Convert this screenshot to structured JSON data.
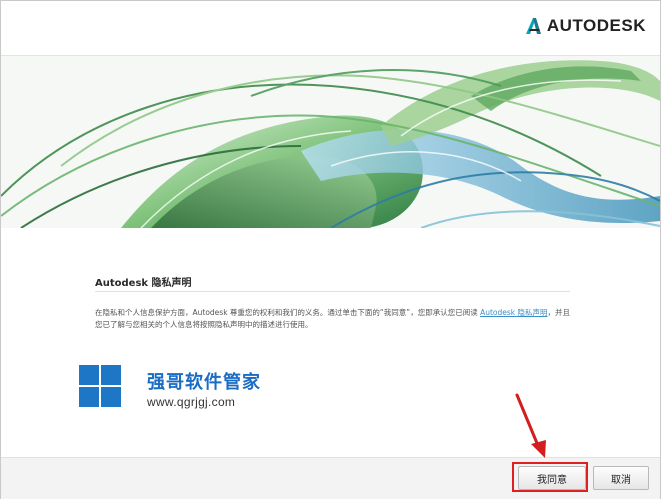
{
  "header": {
    "brand_name": "AUTODESK",
    "logo_icon": "autodesk-a-logo-icon"
  },
  "banner": {
    "image": "abstract-green-blue-ribbons-artwork"
  },
  "privacy": {
    "title": "Autodesk 隐私声明",
    "body_part1": "在隐私和个人信息保护方面，Autodesk 尊重您的权利和我们的义务。通过单击下面的“我同意”，您即承认您已阅读 ",
    "link_text": "Autodesk 隐私声明",
    "body_part2": "，并且您已了解与您相关的个人信息将按照隐私声明中的描述进行使用。"
  },
  "watermark": {
    "logo_icon": "windows-logo-icon",
    "site_name": "强哥软件管家",
    "site_url": "www.qgrjgj.com"
  },
  "footer": {
    "agree_label": "我同意",
    "cancel_label": "取消"
  },
  "annotation": {
    "highlight_color": "#e02020",
    "arrow_icon": "red-arrow-icon"
  }
}
